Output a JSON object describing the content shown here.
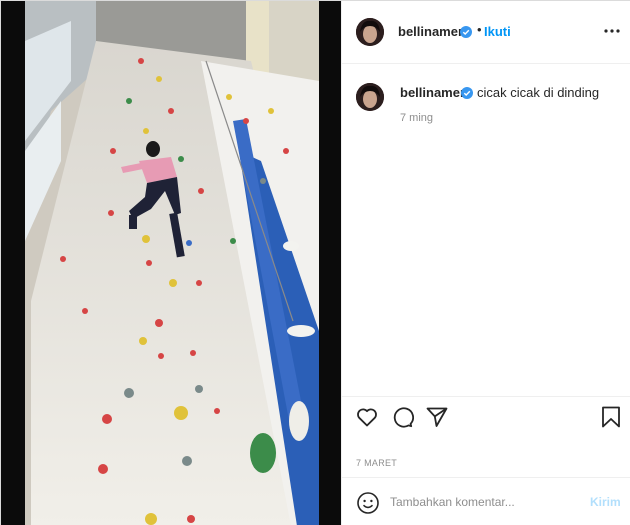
{
  "post": {
    "username": "bellinamer",
    "verified": true,
    "dot": "•",
    "follow_label": "Ikuti",
    "more_icon": "more-horizontal-icon",
    "caption_text": "cicak cicak di dinding",
    "caption_time": "7 ming",
    "date": "7 MARET",
    "comment_placeholder": "Tambahkan komentar...",
    "send_label": "Kirim",
    "colors": {
      "accent": "#0095f6",
      "send_disabled": "#b2dffc",
      "muted": "#8e8e8e",
      "verified": "#3897f0"
    },
    "actions": [
      {
        "icon": "heart-icon"
      },
      {
        "icon": "comment-icon"
      },
      {
        "icon": "share-icon"
      },
      {
        "icon": "bookmark-icon"
      }
    ]
  }
}
